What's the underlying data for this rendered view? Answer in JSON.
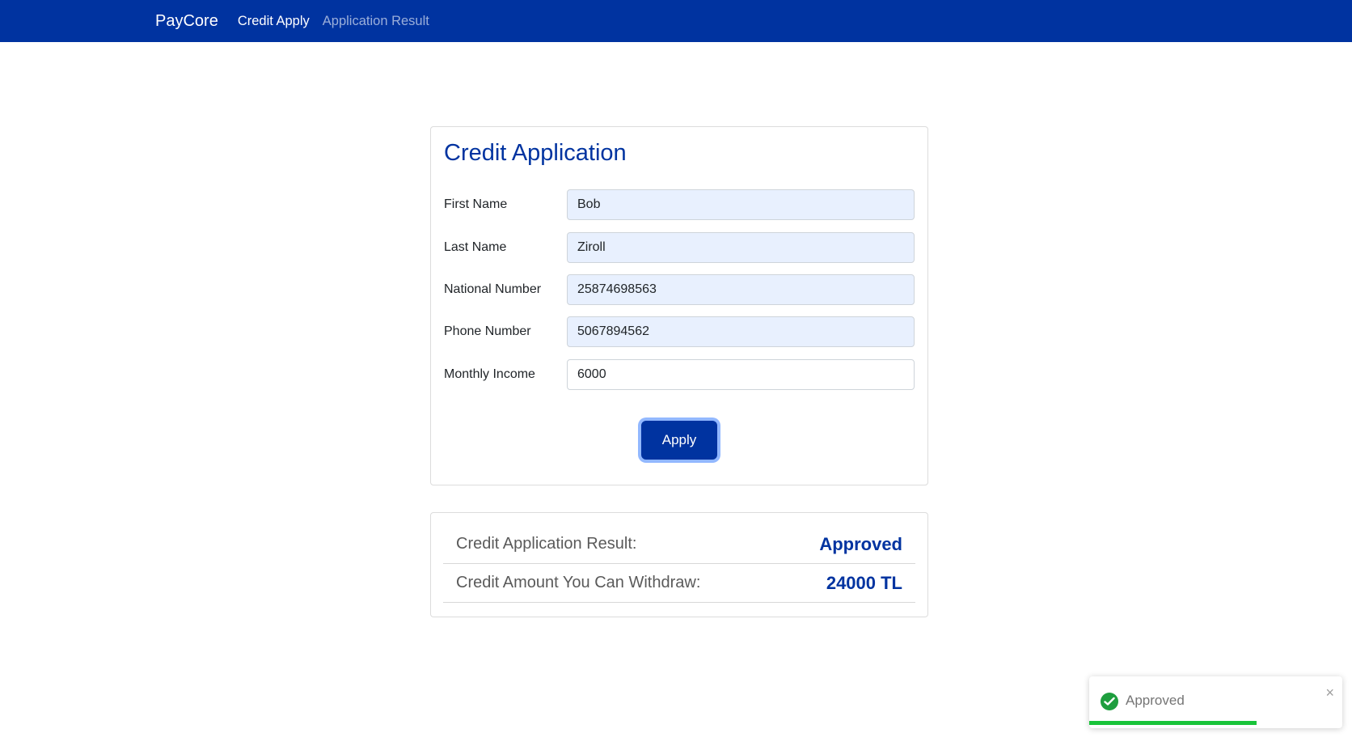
{
  "nav": {
    "brand": "PayCore",
    "links": [
      {
        "label": "Credit Apply",
        "active": true
      },
      {
        "label": "Application Result",
        "active": false
      }
    ]
  },
  "form": {
    "title": "Credit Application",
    "fields": [
      {
        "label": "First Name",
        "value": "Bob"
      },
      {
        "label": "Last Name",
        "value": "Ziroll"
      },
      {
        "label": "National Number",
        "value": "25874698563"
      },
      {
        "label": "Phone Number",
        "value": "5067894562"
      },
      {
        "label": "Monthly Income",
        "value": "6000"
      }
    ],
    "submit_label": "Apply"
  },
  "result": {
    "rows": [
      {
        "label": "Credit Application Result:",
        "value": "Approved"
      },
      {
        "label": "Credit Amount You Can Withdraw:",
        "value": "24000 TL"
      }
    ]
  },
  "toast": {
    "message": "Approved",
    "close_symbol": "×",
    "progress_fraction": 0.66,
    "icon": "check-circle-icon"
  },
  "colors": {
    "brand": "#0033a0",
    "success": "#19c43a"
  }
}
